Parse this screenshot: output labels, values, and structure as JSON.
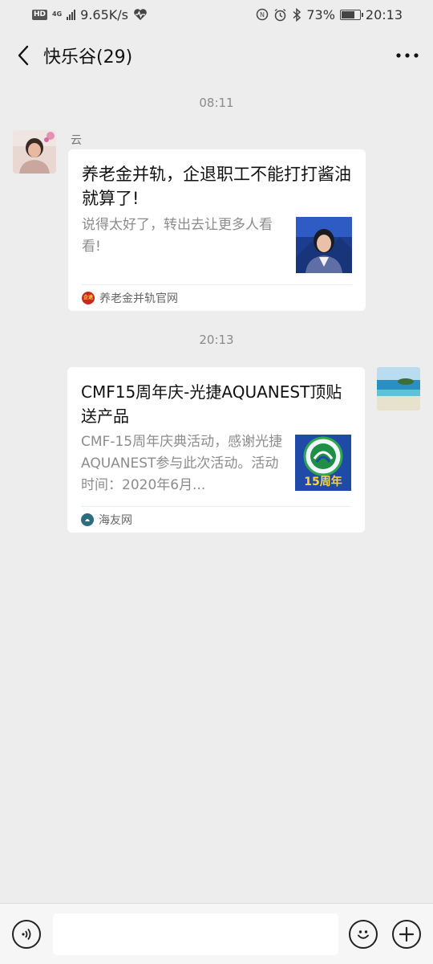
{
  "status_bar": {
    "hd": "HD",
    "network": "4G",
    "speed": "9.65K/s",
    "battery_percent": "73%",
    "battery_level": 0.73,
    "time": "20:13"
  },
  "header": {
    "title": "快乐谷(29)"
  },
  "messages": [
    {
      "timestamp": "08:11",
      "sender": "云",
      "card": {
        "title": "养老金并轨，企退职工不能打打酱油就算了!",
        "description": "说得太好了，转出去让更多人看看!",
        "source": "养老金并轨官网",
        "source_icon_text": "企退",
        "thumb_icon": "news-anchor-thumbnail"
      }
    },
    {
      "timestamp": "20:13",
      "card": {
        "title": "CMF15周年庆-光捷AQUANEST顶贴送产品",
        "description": "CMF-15周年庆典活动，感谢光捷AQUANEST参与此次活动。活动时间：2020年6月...",
        "source": "海友网",
        "thumb_text": "15周年",
        "thumb_icon": "anniversary-badge-thumbnail"
      }
    }
  ],
  "colors": {
    "background": "#ededed",
    "card": "#ffffff",
    "muted_text": "#8c8c8c"
  },
  "input_bar": {
    "voice_icon": "voice-icon",
    "emoji_icon": "emoji-icon",
    "plus_icon": "plus-icon"
  }
}
